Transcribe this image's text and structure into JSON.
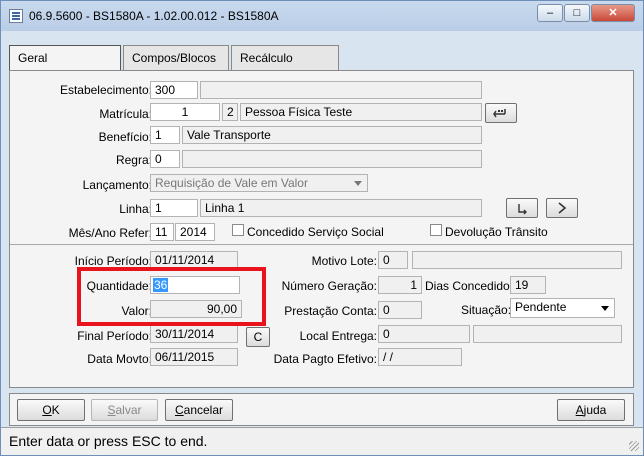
{
  "window": {
    "title": "06.9.5600 - BS1580A - 1.02.00.012 - BS1580A",
    "minimize": "–",
    "maximize": "□",
    "close": "✕"
  },
  "tabs": [
    {
      "label": "Geral"
    },
    {
      "label": "Compos/Blocos"
    },
    {
      "label": "Recálculo"
    }
  ],
  "form": {
    "estabelecimento": {
      "label": "Estabelecimento:",
      "value": "300",
      "name": ""
    },
    "matricula": {
      "label": "Matrícula:",
      "value": "1",
      "seq": "2",
      "name": "Pessoa Física Teste"
    },
    "beneficio": {
      "label": "Benefício:",
      "value": "1",
      "name": "Vale Transporte"
    },
    "regra": {
      "label": "Regra:",
      "value": "0",
      "name": ""
    },
    "lancamento": {
      "label": "Lançamento:",
      "value": "Requisição de Vale em Valor"
    },
    "linha": {
      "label": "Linha:",
      "value": "1",
      "name": "Linha 1"
    },
    "mes_ano": {
      "label": "Mês/Ano Refer:",
      "month": "11",
      "year": "2014"
    },
    "concedido_servico_social": {
      "label": "Concedido Serviço Social",
      "checked": false
    },
    "devolucao_transito": {
      "label": "Devolução Trânsito",
      "checked": false
    }
  },
  "details": {
    "inicio_periodo": {
      "label": "Início Período:",
      "value": "01/11/2014"
    },
    "quantidade": {
      "label": "Quantidade:",
      "value": "36"
    },
    "valor": {
      "label": "Valor:",
      "value": "90,00"
    },
    "final_periodo": {
      "label": "Final Período:",
      "value": "30/11/2014"
    },
    "data_movto": {
      "label": "Data Movto:",
      "value": "06/11/2015"
    },
    "c_button": "C",
    "motivo_lote": {
      "label": "Motivo Lote:",
      "value": "0",
      "desc": ""
    },
    "numero_geracao": {
      "label": "Número Geração:",
      "value": "1"
    },
    "dias_concedidos": {
      "label": "Dias Concedidos:",
      "value": "19"
    },
    "prestacao_conta": {
      "label": "Prestação Conta:",
      "value": "0"
    },
    "situacao": {
      "label": "Situação:",
      "value": "Pendente"
    },
    "local_entrega": {
      "label": "Local Entrega:",
      "value": "0",
      "desc": ""
    },
    "data_pagto_efetivo": {
      "label": "Data Pagto Efetivo:",
      "value": " / /"
    }
  },
  "buttons": {
    "ok": {
      "mnemonic": "O",
      "rest": "K"
    },
    "salvar": {
      "mnemonic": "S",
      "rest": "alvar"
    },
    "cancelar": {
      "mnemonic": "C",
      "rest": "ancelar"
    },
    "ajuda": {
      "mnemonic": "A",
      "rest": "juda"
    }
  },
  "status_bar": "Enter data or press ESC to end.",
  "colors": {
    "highlight": "#e8131c",
    "window_frame": "#d8e4f0"
  },
  "icons": [
    "app-icon",
    "zoom-icon",
    "check-down-icon",
    "arrow-right-icon"
  ]
}
